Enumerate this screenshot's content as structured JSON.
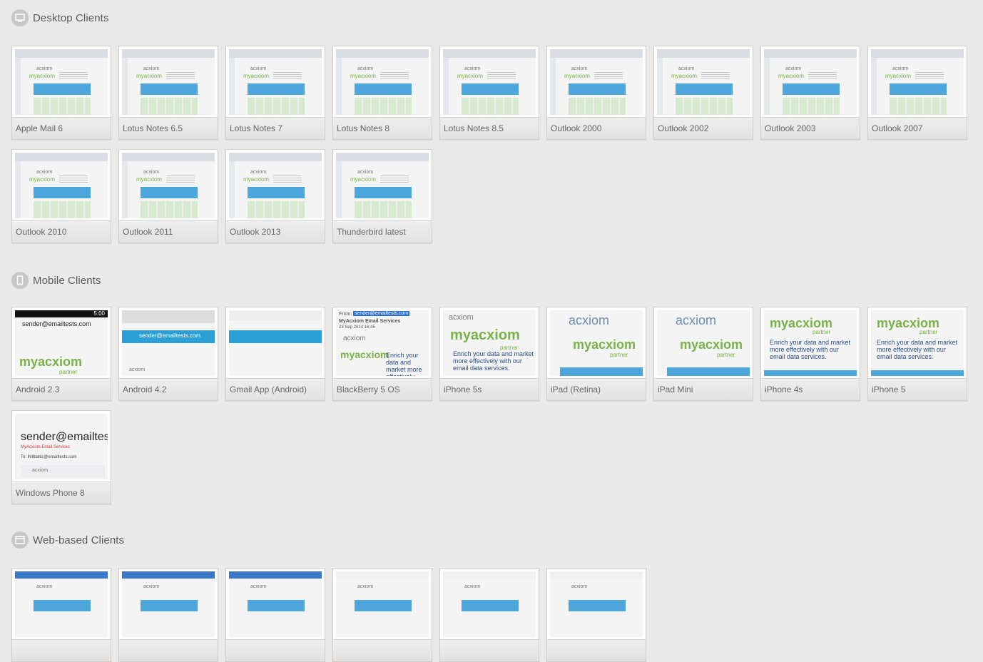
{
  "sections": {
    "desktop": {
      "title": "Desktop Clients",
      "clients": [
        "Apple Mail 6",
        "Lotus Notes 6.5",
        "Lotus Notes 7",
        "Lotus Notes 8",
        "Lotus Notes 8.5",
        "Outlook 2000",
        "Outlook 2002",
        "Outlook 2003",
        "Outlook 2007",
        "Outlook 2010",
        "Outlook 2011",
        "Outlook 2013",
        "Thunderbird latest"
      ]
    },
    "mobile": {
      "title": "Mobile Clients",
      "clients": [
        "Android 2.3",
        "Android 4.2",
        "Gmail App (Android)",
        "BlackBerry 5 OS",
        "iPhone 5s",
        "iPad (Retina)",
        "iPad Mini",
        "iPhone 4s",
        "iPhone 5",
        "Windows Phone 8"
      ]
    },
    "web": {
      "title": "Web-based Clients",
      "clients": [
        "",
        "",
        "",
        "",
        "",
        ""
      ]
    }
  },
  "thumb_text": {
    "acxiom": "acxiom",
    "myacxiom": "myacxiom",
    "partner": "partner",
    "enrich": "Enrich your data and market more effectively with our email data services.",
    "sender": "sender@emailtest",
    "android_time": "5:00",
    "bb_from": "From:",
    "bb_email": "sender@emailtests.com",
    "bb_subject": "MyAcxiom Email Services",
    "bb_date": "23 Sep 2014 16:45",
    "wp_subject": "MyAcxiom Email Services",
    "wp_to": "To: lhillbaltic@emailtests.com",
    "sender_email": "sender@emailtests.com"
  },
  "colors": {
    "background": "#eceae8",
    "band_blue": "#4ea7dc",
    "acxiom_green": "#7ab24a"
  }
}
